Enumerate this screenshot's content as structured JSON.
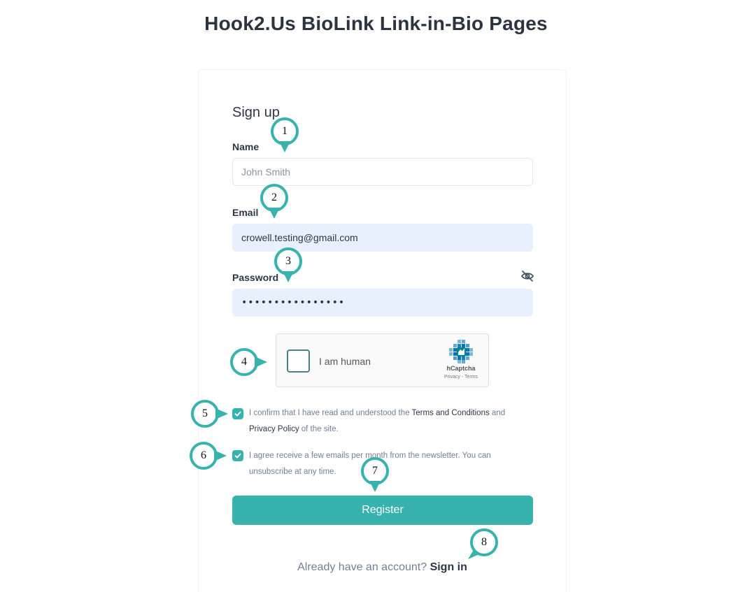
{
  "page": {
    "title": "Hook2.Us BioLink Link-in-Bio Pages"
  },
  "form": {
    "heading": "Sign up",
    "name": {
      "label": "Name",
      "placeholder": "John Smith",
      "value": ""
    },
    "email": {
      "label": "Email",
      "value": "crowell.testing@gmail.com"
    },
    "password": {
      "label": "Password",
      "value": "••••••••••••••••",
      "toggle_icon": "eye-off-icon"
    },
    "captcha": {
      "label": "I am human",
      "brand": "hCaptcha",
      "links": "Privacy - Terms",
      "checked": false
    },
    "terms": {
      "checked": true,
      "text_1": "I confirm that I have read and understood the ",
      "link_terms": "Terms and Conditions",
      "text_2": " and ",
      "link_privacy": "Privacy Policy",
      "text_3": " of the site."
    },
    "newsletter": {
      "checked": true,
      "text": "I agree receive a few emails per month from the newsletter. You can unsubscribe at any time."
    },
    "register_label": "Register",
    "signin_prompt": "Already have an account?",
    "signin_label": "Sign in"
  },
  "annotations": {
    "markers": [
      "1",
      "2",
      "3",
      "4",
      "5",
      "6",
      "7",
      "8"
    ],
    "color": "#38b2ac"
  },
  "colors": {
    "accent": "#38b2ac",
    "autofill": "#e8f0fe",
    "text": "#2d3748",
    "muted": "#718096"
  }
}
